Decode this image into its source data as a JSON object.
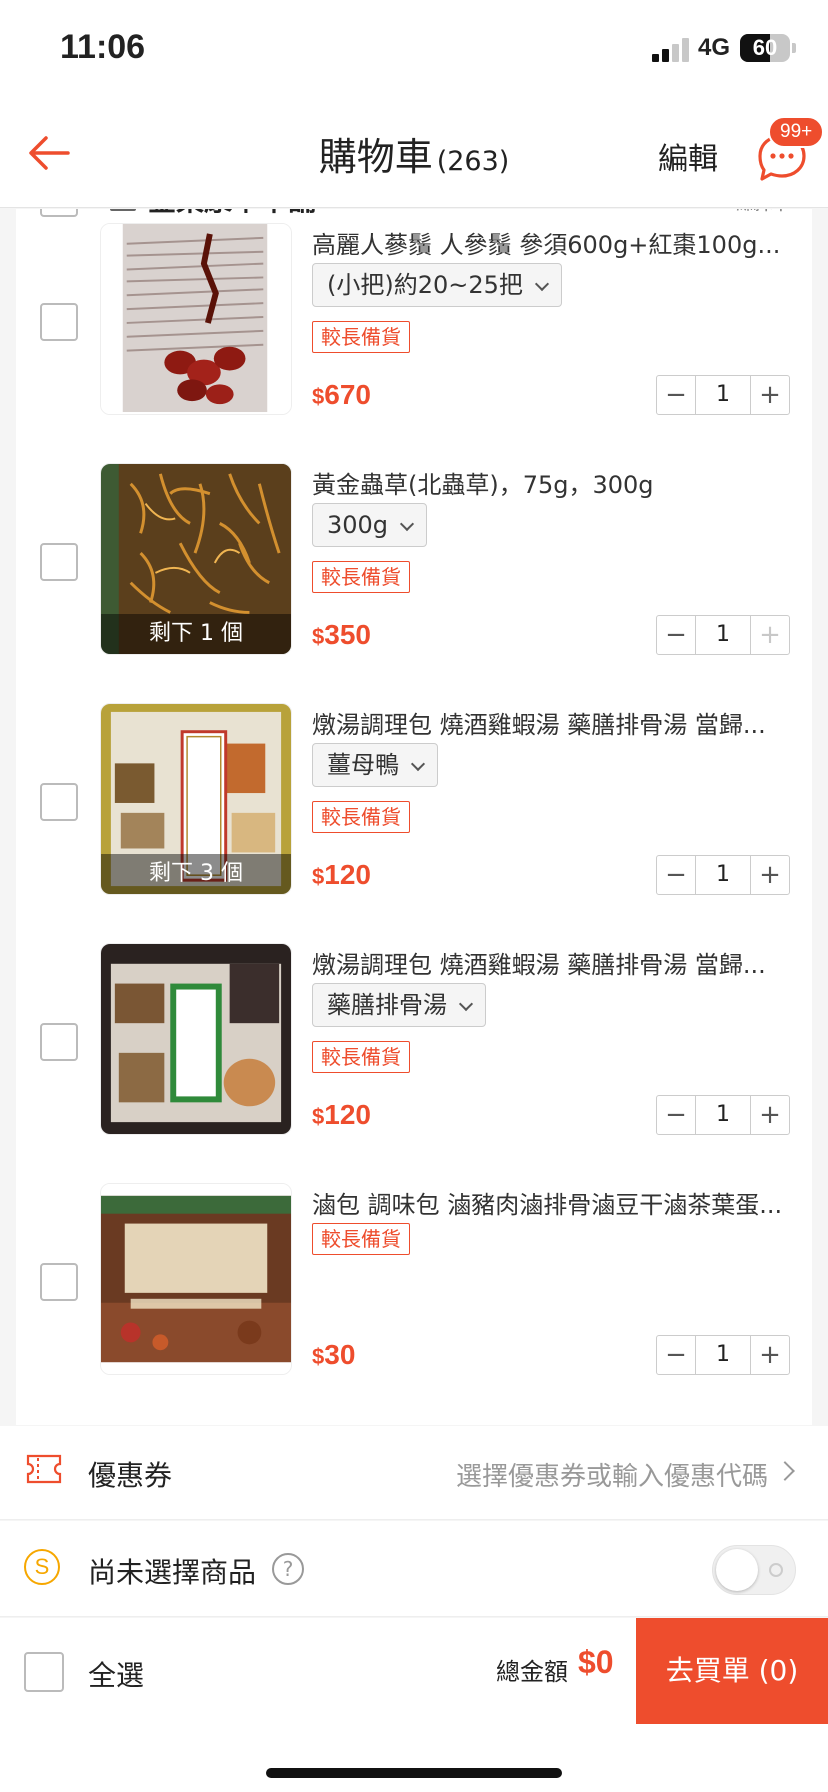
{
  "status": {
    "time": "11:06",
    "network": "4G",
    "battery": "60",
    "battery_level": 0.6
  },
  "header": {
    "title": "購物車",
    "count": "(263)",
    "edit": "編輯",
    "chat_badge": "99+"
  },
  "shop": {
    "name": "金東康草本舖",
    "edit": "編輯"
  },
  "items": [
    {
      "name": "高麗人蔘鬚 人參鬚 參須600g+紅棗100g...",
      "variant": "(小把)約20~25把",
      "tag": "較長備貨",
      "currency": "$",
      "price": "670",
      "qty": "1",
      "stock": "",
      "plus_disabled": false
    },
    {
      "name": "黃金蟲草(北蟲草)，75g，300g",
      "variant": "300g",
      "tag": "較長備貨",
      "currency": "$",
      "price": "350",
      "qty": "1",
      "stock": "剩下 1 個",
      "plus_disabled": true
    },
    {
      "name": "燉湯調理包 燒酒雞蝦湯 藥膳排骨湯 當歸...",
      "variant": "薑母鴨",
      "tag": "較長備貨",
      "currency": "$",
      "price": "120",
      "qty": "1",
      "stock": "剩下 3 個",
      "plus_disabled": false
    },
    {
      "name": "燉湯調理包 燒酒雞蝦湯 藥膳排骨湯 當歸...",
      "variant": "藥膳排骨湯",
      "tag": "較長備貨",
      "currency": "$",
      "price": "120",
      "qty": "1",
      "stock": "",
      "plus_disabled": false
    },
    {
      "name": "滷包 調味包 滷豬肉滷排骨滷豆干滷茶葉蛋...",
      "variant": "",
      "tag": "較長備貨",
      "currency": "$",
      "price": "30",
      "qty": "1",
      "stock": "",
      "plus_disabled": false
    }
  ],
  "stepper": {
    "minus": "−",
    "plus": "+"
  },
  "coupon": {
    "label": "優惠券",
    "hint": "選擇優惠券或輸入優惠代碼"
  },
  "coins": {
    "label": "尚未選擇商品",
    "icon_text": "S",
    "help": "?"
  },
  "checkout": {
    "select_all": "全選",
    "total_label": "總金額",
    "total": "$0",
    "buy": "去買單 (0)"
  },
  "colors": {
    "accent": "#ee4d2d",
    "coin": "#f6a700"
  },
  "icons": {
    "back": "arrow-left-icon",
    "chat": "chat-bubble-icon",
    "coupon": "ticket-icon",
    "coin": "coin-icon",
    "help": "question-circle-icon"
  }
}
